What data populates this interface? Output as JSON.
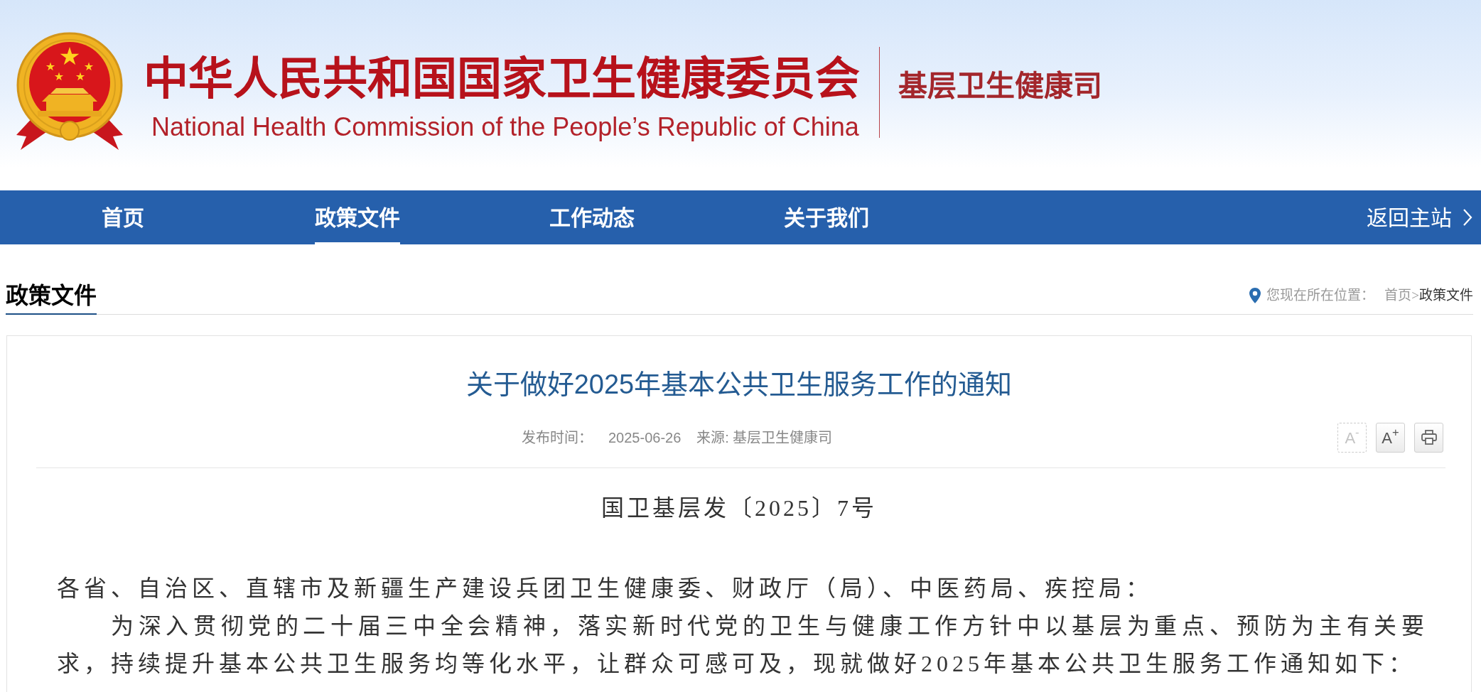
{
  "header": {
    "title_cn": "中华人民共和国国家卫生健康委员会",
    "title_en": "National Health Commission of the People’s Republic of China",
    "department": "基层卫生健康司"
  },
  "nav": {
    "items": [
      {
        "label": "首页",
        "selected": false
      },
      {
        "label": "政策文件",
        "selected": true
      },
      {
        "label": "工作动态",
        "selected": false
      },
      {
        "label": "关于我们",
        "selected": false
      }
    ],
    "back_link": "返回主站"
  },
  "section": {
    "heading": "政策文件",
    "breadcrumb": {
      "label": "您现在所在位置：",
      "separator": ">",
      "items": [
        {
          "text": "首页",
          "current": false
        },
        {
          "text": "政策文件",
          "current": true
        }
      ]
    }
  },
  "article": {
    "title": "关于做好2025年基本公共卫生服务工作的通知",
    "meta": {
      "date_label": "发布时间：",
      "date": "2025-06-26",
      "source": "来源: 基层卫生健康司"
    },
    "tools": [
      {
        "kind": "font_smaller",
        "label": "A$^{-}$",
        "disabled": true
      },
      {
        "kind": "font_larger",
        "label": "A$^{+}$",
        "disabled": false
      },
      {
        "kind": "print",
        "disabled": false
      }
    ],
    "doc_number": "国卫基层发〔2025〕7号",
    "paragraphs": [
      {
        "kind": "salutation",
        "text": "各省、自治区、直辖市及新疆生产建设兵团卫生健康委、财政厅（局）、中医药局、疾控局："
      },
      {
        "kind": "body",
        "text": "为深入贯彻党的二十届三中全会精神，落实新时代党的卫生与健康工作方针中以基层为重点、预防为主有关要求，持续提升基本公共卫生服务均等化水平，让群众可感可及，现就做好2025年基本公共卫生服务工作通知如下："
      }
    ]
  }
}
